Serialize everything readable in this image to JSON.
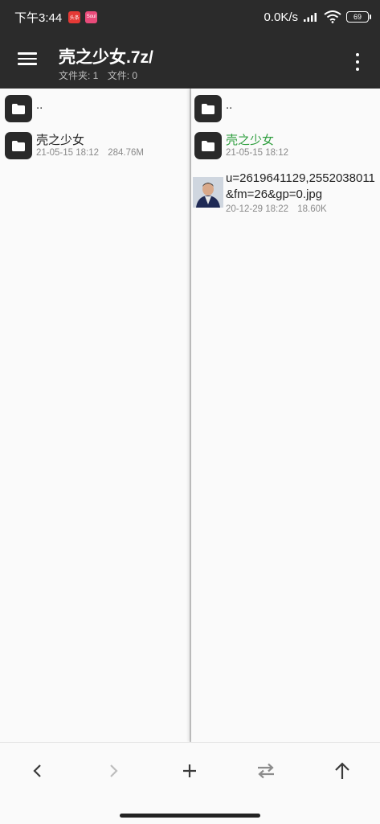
{
  "status_bar": {
    "time": "下午3:44",
    "app_icon_1": "头条",
    "app_icon_2": "Soul",
    "net_speed": "0.0K/s",
    "battery": "69"
  },
  "toolbar": {
    "title": "壳之少女.7z/",
    "folders_label": "文件夹: 1",
    "files_label": "文件: 0",
    "menu_icon": "hamburger-menu-icon",
    "more_icon": "more-vertical-icon"
  },
  "left_pane": {
    "items": [
      {
        "name": "..",
        "type": "parent-folder"
      },
      {
        "name": "壳之少女",
        "type": "folder",
        "date": "21-05-15 18:12",
        "size": "284.76M"
      }
    ]
  },
  "right_pane": {
    "items": [
      {
        "name": "..",
        "type": "parent-folder"
      },
      {
        "name": "壳之少女",
        "type": "folder",
        "date": "21-05-15 18:12",
        "color": "#2e9e3e"
      },
      {
        "name": "u=2619641129,2552038011&fm=26&gp=0.jpg",
        "type": "image",
        "date": "20-12-29 18:22",
        "size": "18.60K"
      }
    ]
  },
  "bottom_bar": {
    "buttons": [
      "back-arrow-icon",
      "forward-arrow-icon",
      "add-icon",
      "swap-icon",
      "up-arrow-icon"
    ]
  },
  "colors": {
    "toolbar_bg": "#2b2b2b",
    "highlight_green": "#2e9e3e",
    "pane_bg": "#fafafa"
  }
}
